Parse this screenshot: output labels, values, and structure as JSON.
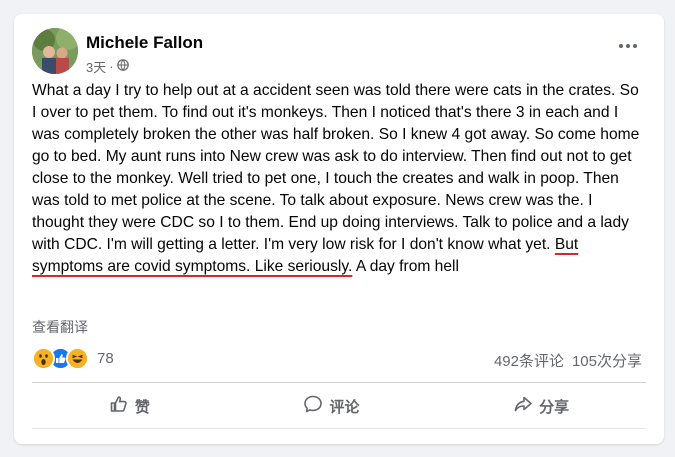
{
  "post": {
    "author": "Michele Fallon",
    "time": "3天",
    "privacy_icon": "globe-icon",
    "body_main": "What a day I try to help out  at a accident seen was told there were cats  in the crates. So I over to pet them. To find out it's monkeys. Then I noticed that's there 3 in each and I was completely broken the other was half broken. So I knew 4 got away. So come home go to bed. My aunt runs into New crew was ask to do interview. Then find out not to get close to the monkey. Well tried to pet one, I touch the creates and walk in poop. Then was told to met police at the scene. To talk about exposure. News crew was the. I thought they were CDC so I to them. End up doing interviews. Talk to police and a lady with CDC. I'm will getting a letter. I'm very low risk for I don't know what yet. ",
    "body_highlight": "But symptoms are covid symptoms. Like seriously.",
    "body_end": "  A day from hell",
    "see_translation": "查看翻译",
    "reaction_count": "78",
    "comments": "492条评论",
    "shares": "105次分享"
  },
  "actions": {
    "like": "赞",
    "comment": "评论",
    "share": "分享"
  },
  "colors": {
    "highlight_underline": "#d12a2a",
    "like_blue": "#1877f2",
    "wow_yellow": "#f7b125"
  }
}
